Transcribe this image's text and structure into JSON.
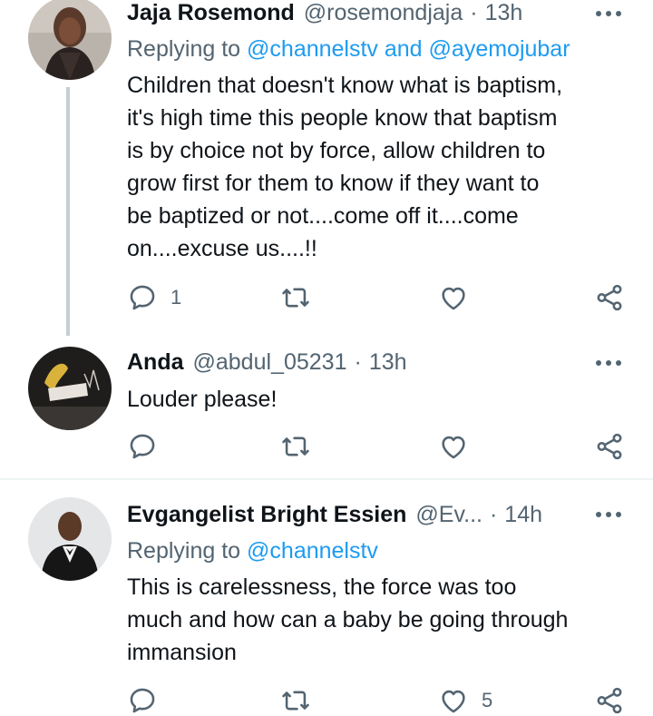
{
  "tweets": [
    {
      "name": "Jaja Rosemond",
      "handle": "@rosemondjaja",
      "sep": "·",
      "time": "13h",
      "replying_prefix": "Replying to ",
      "replying_mentions": "@channelstv and @ayemojubar",
      "lines": [
        "Children that doesn't know what is baptism,",
        "it's high time this people know that baptism",
        "is by choice not by force, allow children to",
        "grow first for them to know if they want to",
        "be baptized or not....come off it....come",
        "on....excuse us....!!"
      ],
      "reply_count": "1",
      "retweet_count": "",
      "like_count": ""
    },
    {
      "name": "Anda",
      "handle": "@abdul_05231",
      "sep": "·",
      "time": "13h",
      "lines": [
        "Louder please!"
      ],
      "reply_count": "",
      "retweet_count": "",
      "like_count": ""
    },
    {
      "name": "Evgangelist Bright Essien",
      "handle": "@Ev...",
      "sep": "·",
      "time": "14h",
      "replying_prefix": "Replying to ",
      "replying_mentions": "@channelstv",
      "lines": [
        "This is carelessness, the force was too",
        "much and how can a baby be going through",
        "immansion"
      ],
      "reply_count": "",
      "retweet_count": "",
      "like_count": "5"
    }
  ],
  "icons": {
    "reply": "reply-icon",
    "retweet": "retweet-icon",
    "like": "heart-icon",
    "share": "share-icon",
    "more": "more-icon"
  },
  "colors": {
    "link": "#1d9bf0",
    "secondary": "#536471",
    "thread_line": "#c4cfd6",
    "divider": "#eff3f4"
  }
}
